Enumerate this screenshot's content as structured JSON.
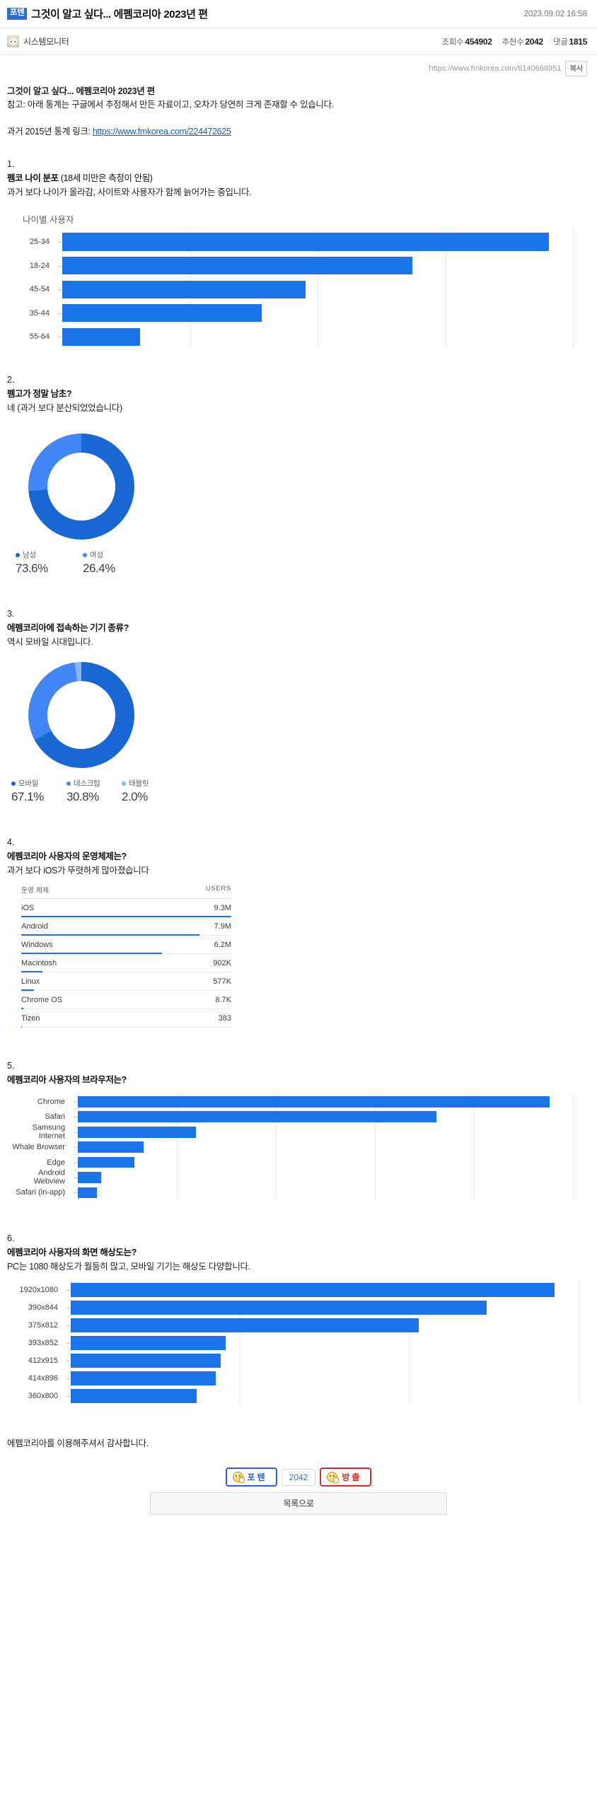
{
  "header": {
    "badge": "포텐",
    "title": "그것이 알고 싶다... 에펨코리아 2023년 편",
    "date": "2023.09.02 16:58",
    "author": "시스템모니터",
    "views_label": "조회수",
    "views_value": "454902",
    "likes_label": "추천수",
    "likes_value": "2042",
    "comments_label": "댓글",
    "comments_value": "1815",
    "url": "https://www.fmkorea.com/6140668951",
    "copy_label": "복사"
  },
  "intro": {
    "title": "그것이 알고 싶다... 에펨코리아 2023년 편",
    "note": "참고: 아래 통계는 구글에서 추정해서 만든 자료이고, 오차가 당연히 크게 존재할 수 있습니다.",
    "link_prefix": "과거 2015년 통계 링크: ",
    "link_text": "https://www.fmkorea.com/224472625"
  },
  "sections": [
    {
      "num": "1.",
      "question": "펨코 나이 분포",
      "question_suffix": " (18세 미만은 측정이 안됨)",
      "comment": "과거 보다 나이가 올라감, 사이트와 사용자가 함께 늙어가는 중입니다."
    },
    {
      "num": "2.",
      "question": "펨고가 정말 남초?",
      "comment": "네 (과거 보다 분산되었었습니다)"
    },
    {
      "num": "3.",
      "question": "에펨코리아에 접속하는 기기 종류?",
      "comment": "역시 모바일 시대입니다."
    },
    {
      "num": "4.",
      "question": "에펨코리아 사용자의 운영체제는?",
      "comment": "과거 보다 iOS가 뚜렷하게 많아졌습니다"
    },
    {
      "num": "5.",
      "question": "에펨코리아 사용자의 브라우저는?",
      "comment": ""
    },
    {
      "num": "6.",
      "question": "에펨코리아 사용자의 화면 해상도는?",
      "comment": "PC는 1080 해상도가 월등히 많고, 모바일 기기는 해상도 다양합니다."
    }
  ],
  "footer": {
    "thanks": "에펨코리아를 이용해주셔서 감사합니다.",
    "up_label": "포텐",
    "count": "2042",
    "down_label": "방출",
    "list_label": "목록으로"
  },
  "colors": {
    "bar": "#1a73e8",
    "donut_primary": "#1967d2",
    "donut_secondary": "#4285f4",
    "donut_tertiary": "#8ab4f8",
    "badge_blue": "#2e6bd2",
    "red": "#d32f2f"
  },
  "chart_data": [
    {
      "id": "age",
      "type": "bar",
      "orientation": "horizontal",
      "title": "나이별 사용자",
      "categories": [
        "25-34",
        "18-24",
        "45-54",
        "35-44",
        "55-64"
      ],
      "values": [
        100,
        72,
        50,
        41,
        16
      ],
      "xlabel": "",
      "ylabel": "",
      "xlim": [
        0,
        105
      ],
      "gridlines": 5,
      "grid": true,
      "legend": "none"
    },
    {
      "id": "gender",
      "type": "pie",
      "subtype": "donut",
      "title": "",
      "labels": [
        "남성",
        "여성"
      ],
      "values": [
        73.6,
        26.4
      ],
      "display_values": [
        "73.6%",
        "26.4%"
      ],
      "colors": [
        "#1967d2",
        "#4285f4"
      ],
      "legend": "bottom"
    },
    {
      "id": "device",
      "type": "pie",
      "subtype": "donut",
      "title": "",
      "labels": [
        "모바일",
        "데스크탑",
        "태블릿"
      ],
      "values": [
        67.1,
        30.8,
        2.0
      ],
      "display_values": [
        "67.1%",
        "30.8%",
        "2.0%"
      ],
      "colors": [
        "#1967d2",
        "#4285f4",
        "#8ab4f8"
      ],
      "legend": "bottom"
    },
    {
      "id": "os",
      "type": "table",
      "columns": [
        "운영 체제",
        "USERS"
      ],
      "rows": [
        {
          "name": "iOS",
          "value": "9.3M",
          "pct": 100
        },
        {
          "name": "Android",
          "value": "7.9M",
          "pct": 85
        },
        {
          "name": "Windows",
          "value": "6.2M",
          "pct": 67
        },
        {
          "name": "Macintosh",
          "value": "902K",
          "pct": 10
        },
        {
          "name": "Linux",
          "value": "577K",
          "pct": 6
        },
        {
          "name": "Chrome OS",
          "value": "8.7K",
          "pct": 1
        },
        {
          "name": "Tizen",
          "value": "383",
          "pct": 0.3
        }
      ]
    },
    {
      "id": "browser",
      "type": "bar",
      "orientation": "horizontal",
      "title": "",
      "categories": [
        "Chrome",
        "Safari",
        "Samsung Internet",
        "Whale Browser",
        "Edge",
        "Android Webview",
        "Safari (in-app)"
      ],
      "values": [
        100,
        76,
        25,
        14,
        12,
        5,
        4
      ],
      "xlim": [
        0,
        105
      ],
      "gridlines": 6,
      "grid": true,
      "legend": "none"
    },
    {
      "id": "resolution",
      "type": "bar",
      "orientation": "horizontal",
      "title": "",
      "categories": [
        "1920x1080",
        "390x844",
        "375x812",
        "393x852",
        "412x915",
        "414x896",
        "360x800"
      ],
      "values": [
        100,
        86,
        72,
        32,
        31,
        30,
        26
      ],
      "xlim": [
        0,
        105
      ],
      "gridlines": 4,
      "grid": true,
      "legend": "none"
    }
  ]
}
